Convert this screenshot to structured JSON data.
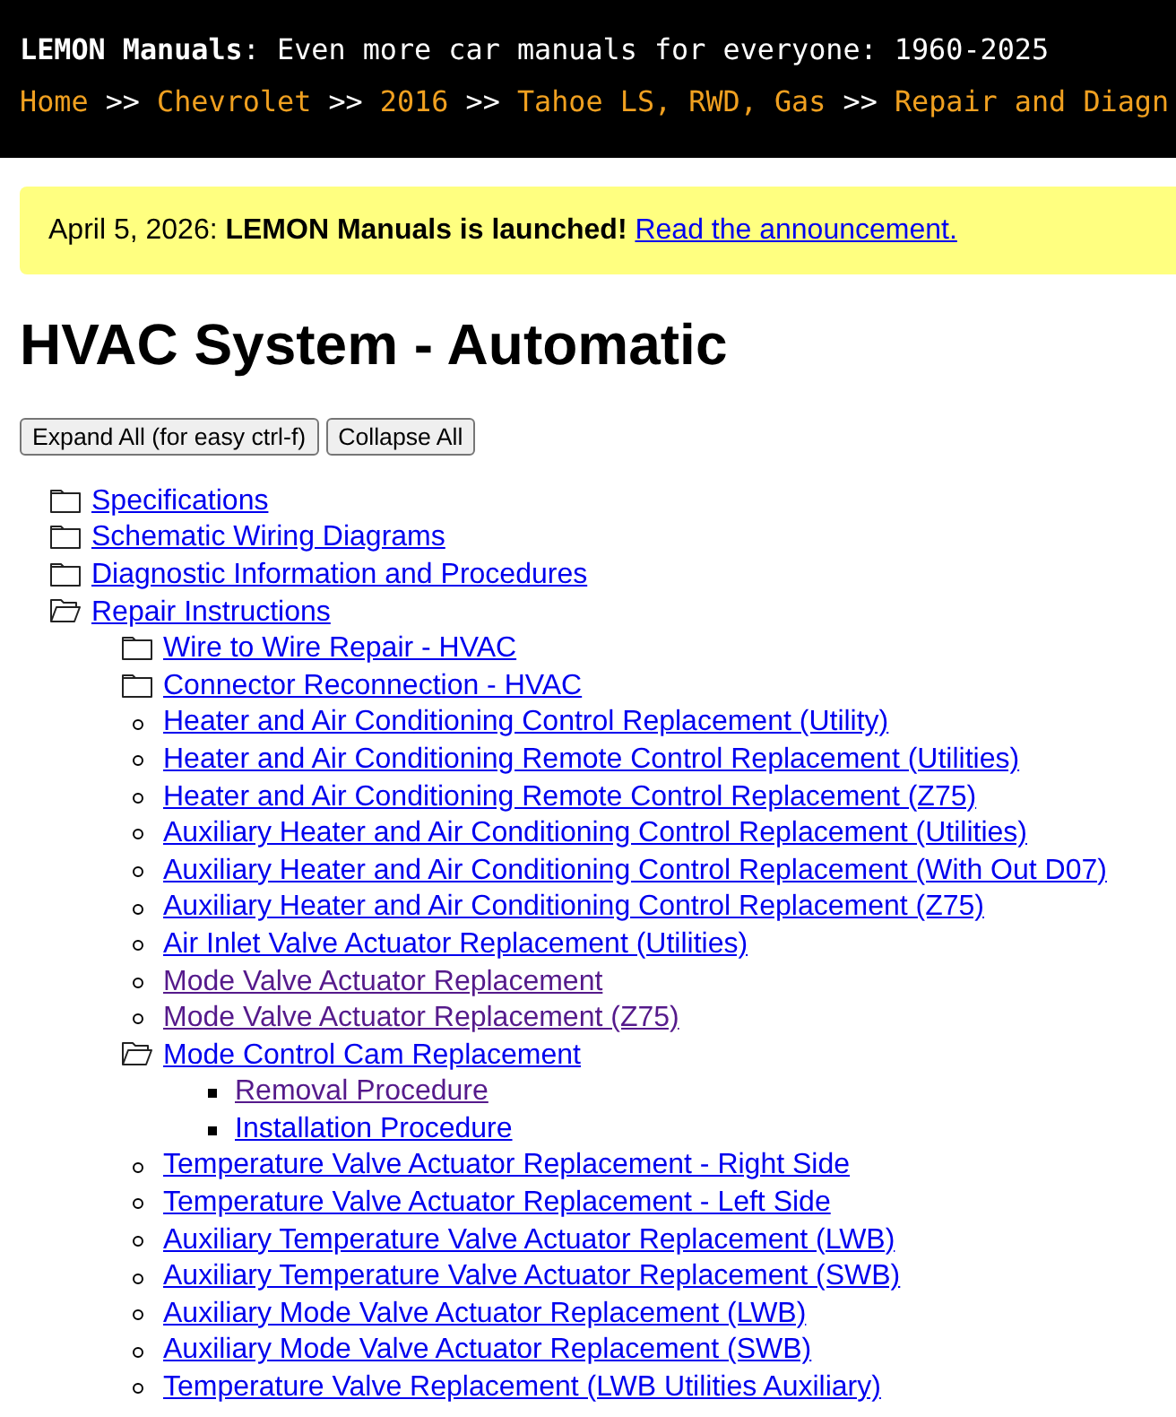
{
  "header": {
    "title": "**LEMON Manuals**: Even more car manuals for everyone: 1960-2025",
    "breadcrumb": [
      {
        "kind": "link",
        "text": "Home"
      },
      {
        "kind": "separator",
        "text": ">>"
      },
      {
        "kind": "link",
        "text": "Chevrolet"
      },
      {
        "kind": "separator",
        "text": ">>"
      },
      {
        "kind": "link",
        "text": "2016"
      },
      {
        "kind": "separator",
        "text": ">>"
      },
      {
        "kind": "link",
        "text": "Tahoe LS, RWD, Gas"
      },
      {
        "kind": "separator",
        "text": ">>"
      },
      {
        "kind": "link",
        "text": "Repair and Diagn"
      }
    ]
  },
  "announcement": {
    "text": "April 5, 2026: **LEMON Manuals is launched!**",
    "link": "Read the announcement."
  },
  "page_title": "HVAC System - Automatic",
  "buttons": {
    "expand_all": "Expand All (for easy ctrl-f)",
    "collapse_all": "Collapse All"
  },
  "tree": [
    {
      "kind": "folder",
      "label": "Specifications",
      "expanded": false,
      "visited": false
    },
    {
      "kind": "folder",
      "label": "Schematic Wiring Diagrams",
      "expanded": false,
      "visited": false
    },
    {
      "kind": "folder",
      "label": "Diagnostic Information and Procedures",
      "expanded": false,
      "visited": false
    },
    {
      "kind": "folder",
      "label": "Repair Instructions",
      "expanded": true,
      "visited": false,
      "children": [
        {
          "kind": "folder",
          "label": "Wire to Wire Repair - HVAC",
          "expanded": false,
          "visited": false
        },
        {
          "kind": "folder",
          "label": "Connector Reconnection - HVAC",
          "expanded": false,
          "visited": false
        },
        {
          "kind": "page",
          "label": "Heater and Air Conditioning Control Replacement (Utility)",
          "visited": false
        },
        {
          "kind": "page",
          "label": "Heater and Air Conditioning Remote Control Replacement (Utilities)",
          "visited": false
        },
        {
          "kind": "page",
          "label": "Heater and Air Conditioning Remote Control Replacement (Z75)",
          "visited": false
        },
        {
          "kind": "page",
          "label": "Auxiliary Heater and Air Conditioning Control Replacement (Utilities)",
          "visited": false
        },
        {
          "kind": "page",
          "label": "Auxiliary Heater and Air Conditioning Control Replacement (With Out D07)",
          "visited": false
        },
        {
          "kind": "page",
          "label": "Auxiliary Heater and Air Conditioning Control Replacement (Z75)",
          "visited": false
        },
        {
          "kind": "page",
          "label": "Air Inlet Valve Actuator Replacement (Utilities)",
          "visited": false
        },
        {
          "kind": "page",
          "label": "Mode Valve Actuator Replacement",
          "visited": true
        },
        {
          "kind": "page",
          "label": "Mode Valve Actuator Replacement (Z75)",
          "visited": true
        },
        {
          "kind": "folder",
          "label": "Mode Control Cam Replacement",
          "expanded": true,
          "visited": false,
          "children": [
            {
              "kind": "page",
              "label": "Removal Procedure",
              "visited": true
            },
            {
              "kind": "page",
              "label": "Installation Procedure",
              "visited": false
            }
          ]
        },
        {
          "kind": "page",
          "label": "Temperature Valve Actuator Replacement - Right Side",
          "visited": false
        },
        {
          "kind": "page",
          "label": "Temperature Valve Actuator Replacement - Left Side",
          "visited": false
        },
        {
          "kind": "page",
          "label": "Auxiliary Temperature Valve Actuator Replacement (LWB)",
          "visited": false
        },
        {
          "kind": "page",
          "label": "Auxiliary Temperature Valve Actuator Replacement (SWB)",
          "visited": false
        },
        {
          "kind": "page",
          "label": "Auxiliary Mode Valve Actuator Replacement (LWB)",
          "visited": false
        },
        {
          "kind": "page",
          "label": "Auxiliary Mode Valve Actuator Replacement (SWB)",
          "visited": false
        },
        {
          "kind": "page",
          "label": "Temperature Valve Replacement (LWB Utilities Auxiliary)",
          "visited": false
        }
      ]
    }
  ]
}
